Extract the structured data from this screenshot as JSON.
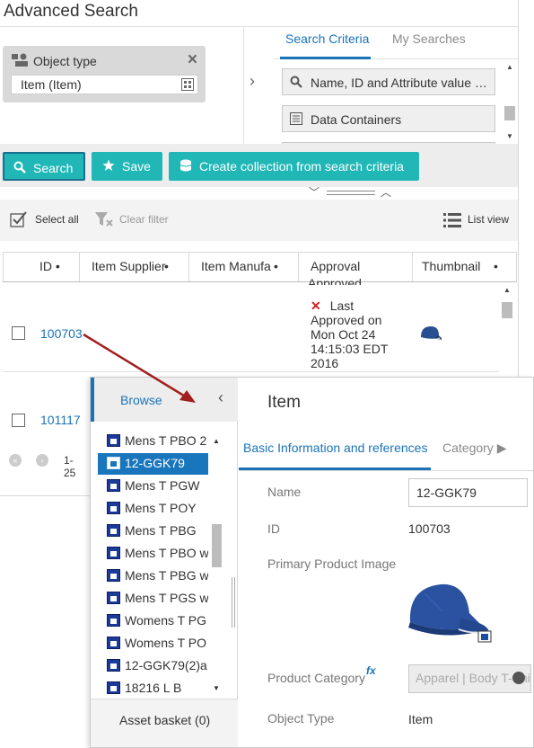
{
  "header": {
    "title": "Advanced Search"
  },
  "object_type": {
    "label": "Object type",
    "value": "Item (Item)"
  },
  "criteria_tabs": [
    {
      "label": "Search Criteria",
      "active": true
    },
    {
      "label": "My Searches",
      "active": false
    }
  ],
  "criteria_items": [
    {
      "label": "Name, ID and Attribute value search",
      "icon": "search-icon"
    },
    {
      "label": "Data Containers",
      "icon": "list-icon"
    }
  ],
  "buttons": {
    "search": "Search",
    "save": "Save",
    "create_collection": "Create collection from search criteria"
  },
  "toolbar": {
    "select_all": "Select all",
    "clear_filter": "Clear filter",
    "list_view": "List view"
  },
  "grid": {
    "columns": [
      "ID",
      "Item Supplier",
      "Item Manufacturer",
      "Approval",
      "Thumbnail"
    ],
    "partial_text": "Approved",
    "rows": [
      {
        "id": "100703",
        "approval": "Last Approved on Mon Oct 24 14:15:03 EDT 2016"
      },
      {
        "id": "101117",
        "approval": ""
      }
    ]
  },
  "pager": {
    "range_text": "1-25"
  },
  "browse": {
    "title": "Browse",
    "items": [
      {
        "label": "Mens T PBO 2",
        "selected": false
      },
      {
        "label": "12-GGK79",
        "selected": true
      },
      {
        "label": "Mens T PGW",
        "selected": false
      },
      {
        "label": "Mens T POY",
        "selected": false
      },
      {
        "label": "Mens T PBG",
        "selected": false
      },
      {
        "label": "Mens T PBO w",
        "selected": false
      },
      {
        "label": "Mens T PBG w",
        "selected": false
      },
      {
        "label": "Mens T PGS w",
        "selected": false
      },
      {
        "label": "Womens T PG",
        "selected": false
      },
      {
        "label": "Womens T PO",
        "selected": false
      },
      {
        "label": "12-GGK79(2)a",
        "selected": false
      },
      {
        "label": "18216 L B",
        "selected": false
      }
    ],
    "asset_basket": "Asset basket (0)"
  },
  "detail": {
    "title": "Item",
    "tabs": [
      {
        "label": "Basic Information and references",
        "active": true
      },
      {
        "label": "Category ▶",
        "active": false
      }
    ],
    "fields": {
      "name_label": "Name",
      "name_value": "12-GGK79",
      "id_label": "ID",
      "id_value": "100703",
      "image_label": "Primary Product Image",
      "category_label": "Product Category",
      "category_value": "Apparel | Body T-Shirts",
      "object_type_label": "Object Type",
      "object_type_value": "Item"
    }
  },
  "colors": {
    "accent_blue": "#1a73b8",
    "button_teal": "#21b7b7",
    "selected_row": "#1976bc",
    "arrow_red": "#a21e1e"
  }
}
